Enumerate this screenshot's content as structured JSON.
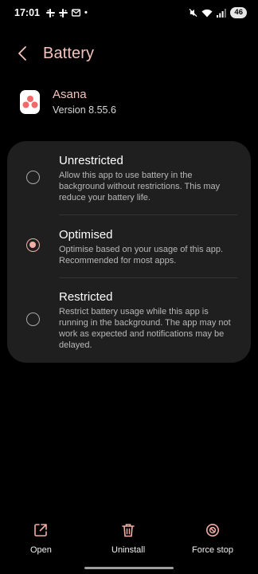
{
  "status_bar": {
    "time": "17:01",
    "notification_icons": [
      "slack-icon",
      "slack-icon",
      "email-icon"
    ],
    "dot": "•",
    "battery": "46"
  },
  "header": {
    "title": "Battery"
  },
  "app": {
    "name": "Asana",
    "version": "Version 8.55.6"
  },
  "options": [
    {
      "title": "Unrestricted",
      "description": "Allow this app to use battery in the background without restrictions. This may reduce your battery life.",
      "selected": false
    },
    {
      "title": "Optimised",
      "description": "Optimise based on your usage of this app. Recommended for most apps.",
      "selected": true
    },
    {
      "title": "Restricted",
      "description": "Restrict battery usage while this app is running in the background. The app may not work as expected and notifications may be delayed.",
      "selected": false
    }
  ],
  "bottom_bar": {
    "open": "Open",
    "uninstall": "Uninstall",
    "force_stop": "Force stop"
  },
  "colors": {
    "accent": "#f2ada5",
    "title": "#f5c4bd",
    "card_bg": "#1f1f1f",
    "background": "#000000",
    "asana_brand": "#f06a6a"
  }
}
